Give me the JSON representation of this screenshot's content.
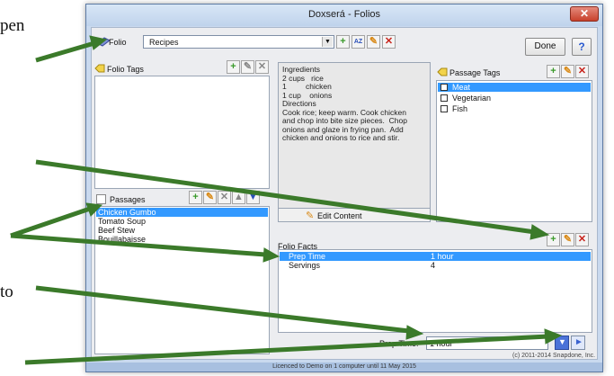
{
  "background": {
    "text_top": "pen",
    "text_bottom": "to"
  },
  "window": {
    "title": "Doxserá - Folios"
  },
  "folio": {
    "label": "Folio",
    "value": "Recipes"
  },
  "toolbar": {
    "done_label": "Done",
    "help_label": "?",
    "sort_icon_text": "AZ"
  },
  "folio_tags": {
    "header": "Folio Tags"
  },
  "content": {
    "text": "Ingredients\n2 cups   rice\n1         chicken\n1 cup    onions\nDirections\nCook rice; keep warm. Cook chicken\nand chop into bite size pieces.  Chop\nonions and glaze in frying pan.  Add\nchicken and onions to rice and stir.",
    "edit_button": "Edit Content"
  },
  "passage_tags": {
    "header": "Passage Tags",
    "items": [
      {
        "label": "Meat",
        "checked": true
      },
      {
        "label": "Vegetarian",
        "checked": false
      },
      {
        "label": "Fish",
        "checked": false
      }
    ]
  },
  "passages": {
    "header": "Passages",
    "items": [
      "Chicken Gumbo",
      "Tomato Soup",
      "Beef Stew",
      "Bouillabaisse"
    ]
  },
  "folio_facts": {
    "header": "Folio Facts",
    "rows": [
      {
        "name": "Prep Time",
        "value": "1 hour"
      },
      {
        "name": "Servings",
        "value": "4"
      }
    ]
  },
  "fact_editor": {
    "label": "Prep Time:",
    "value": "1 hour"
  },
  "footer": {
    "copyright": "(c) 2011-2014 Snapdone, Inc.",
    "status": "Licenced to Demo on 1 computer until 11 May 2015"
  },
  "colors": {
    "accent": "#3399ff",
    "arrow": "#3b7a2a",
    "close": "#c8412c"
  }
}
